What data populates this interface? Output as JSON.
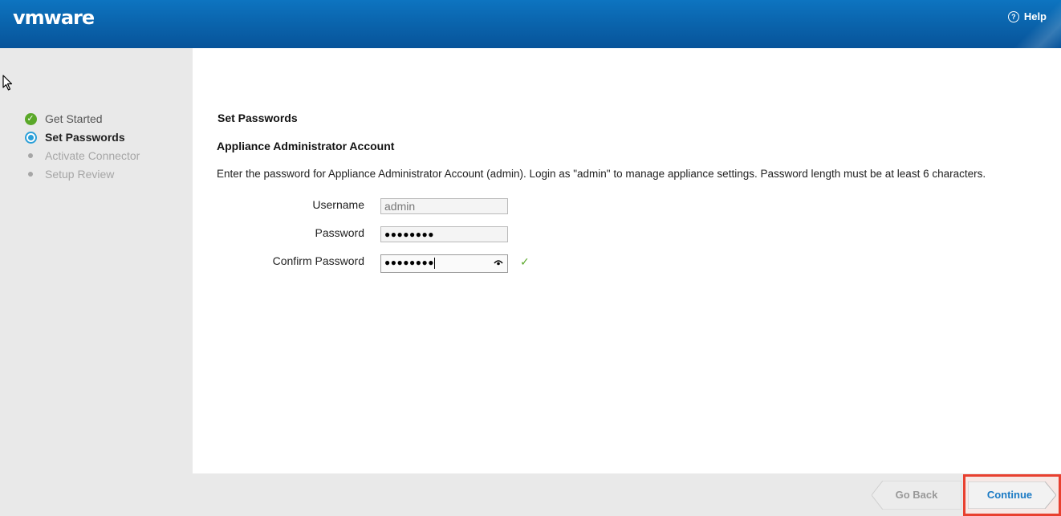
{
  "header": {
    "logo_text": "vmware",
    "help_label": "Help",
    "help_icon": "?"
  },
  "sidebar": {
    "steps": [
      {
        "label": "Get Started",
        "state": "done"
      },
      {
        "label": "Set Passwords",
        "state": "current"
      },
      {
        "label": "Activate Connector",
        "state": "pending"
      },
      {
        "label": "Setup Review",
        "state": "pending"
      }
    ]
  },
  "main": {
    "title": "Set Passwords",
    "subtitle": "Appliance Administrator Account",
    "description": "Enter the password for Appliance Administrator Account (admin). Login as \"admin\" to manage appliance settings. Password length must be at least 6 characters.",
    "form": {
      "username_label": "Username",
      "username_value": "admin",
      "password_label": "Password",
      "password_value": "●●●●●●●●",
      "confirm_label": "Confirm Password",
      "confirm_value": "●●●●●●●●"
    },
    "valid_check": "✓"
  },
  "footer": {
    "back_label": "Go Back",
    "continue_label": "Continue"
  },
  "colors": {
    "header_blue": "#0a62aa",
    "success_green": "#5aa829",
    "step_current_blue": "#2a9fd8",
    "continue_text": "#1a7ac4",
    "highlight_red": "#e8402f"
  }
}
